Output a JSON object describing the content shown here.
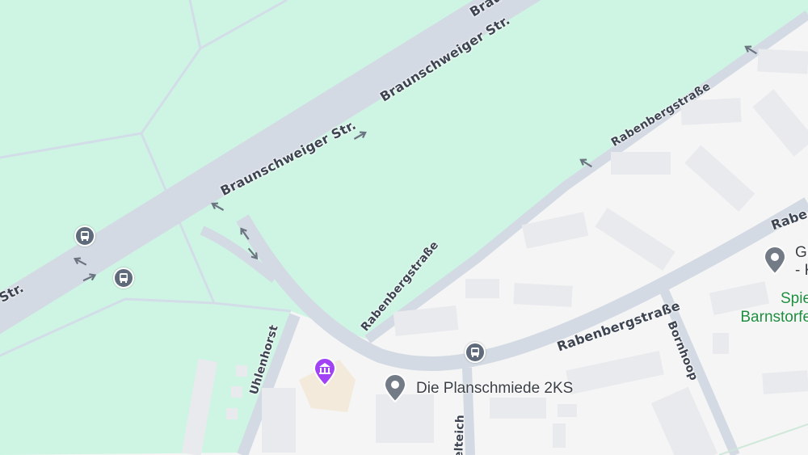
{
  "map": {
    "roads": {
      "braunschweiger_1": "Braunschweiger Str.",
      "braunschweiger_2": "Braunschweiger Str.",
      "braunschweiger_3": "Braunschweiger Str.",
      "braunschweiger_4": "Str.",
      "rabenberg_1": "Rabenbergstraße",
      "rabenberg_2": "Rabenbergstraße",
      "rabenberg_3": "Rabenbergstraße",
      "rabenberg_4": "Rabe",
      "uhlenhorst": "Uhlenhorst",
      "bornhoop": "Bornhoop",
      "elteich": "elteich"
    },
    "pois": {
      "planschmiede": "Die Planschmiede 2KS",
      "top_right_line1": "Gu",
      "top_right_line2": "- K",
      "green_line1": "Spie",
      "green_line2": "Barnstorfe"
    },
    "icons": {
      "bus_stop": "bus-icon",
      "museum": "museum-icon",
      "place_pin": "place-pin-icon",
      "one_way": "arrow-icon"
    },
    "colors": {
      "park": "#cef5e3",
      "urban": "#f5f5f5",
      "road": "#d3dae3",
      "building": "#e8eaed",
      "museum_pin": "#a142f4",
      "place_pin": "#737b86",
      "bus": "#5f6b7a",
      "green_text": "#1e8e3e"
    }
  }
}
